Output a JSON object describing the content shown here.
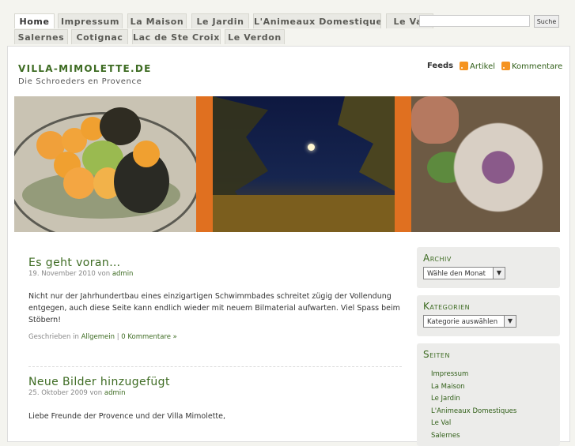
{
  "nav": {
    "tabs": [
      "Home",
      "Impressum",
      "La Maison",
      "Le Jardin",
      "L'Animeaux Domestiques",
      "Le Val",
      "Salernes",
      "Cotignac",
      "Lac de Ste Croix",
      "Le Verdon"
    ],
    "search_button": "Suche"
  },
  "header": {
    "title": "VILLA-MIMOLETTE.DE",
    "subtitle": "Die Schroeders en Provence",
    "feeds_label": "Feeds",
    "feed_articles": "Artikel",
    "feed_comments": "Kommentare"
  },
  "posts": [
    {
      "title": "Es geht voran…",
      "date": "19. November 2010",
      "by": "von",
      "author": "admin",
      "body": "Nicht nur der Jahrhundertbau eines einzigartigen Schwimmbades schreitet zügig der Vollendung entgegen, auch diese Seite kann endlich wieder mit neuem Bilmaterial aufwarten. Viel Spass beim Stöbern!",
      "footer_prefix": "Geschrieben in",
      "category": "Allgemein",
      "separator": "|",
      "comments": "0 Kommentare »"
    },
    {
      "title": "Neue Bilder hinzugefügt",
      "date": "25. Oktober 2009",
      "by": "von",
      "author": "admin",
      "body": "Liebe Freunde der Provence und der Villa Mimolette,"
    }
  ],
  "sidebar": {
    "archive": {
      "title": "Archiv",
      "select": "Wähle den Monat"
    },
    "categories": {
      "title": "Kategorien",
      "select": "Kategorie auswählen"
    },
    "pages": {
      "title": "Seiten",
      "items": [
        "Impressum",
        "La Maison",
        "Le Jardin",
        "L'Animeaux Domestiques",
        "Le Val",
        "Salernes"
      ]
    }
  },
  "colors": {
    "accent": "#3d6b22",
    "banner_stripe": "#e07020",
    "rss": "#f59320"
  }
}
